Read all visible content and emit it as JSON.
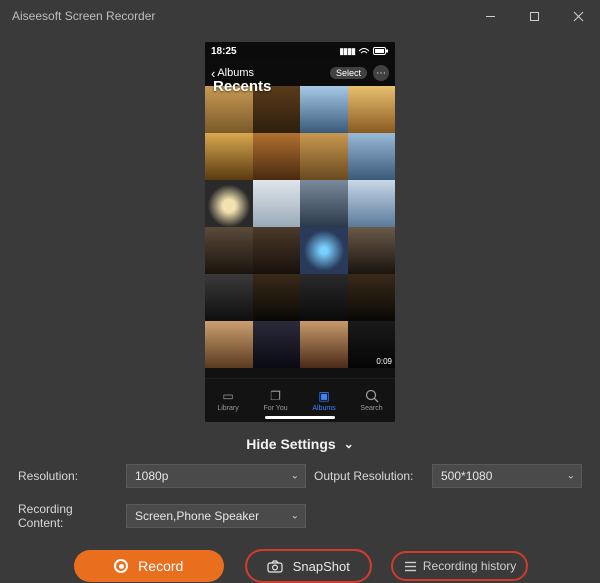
{
  "window": {
    "title": "Aiseesoft Screen Recorder"
  },
  "phone": {
    "status": {
      "time": "18:25"
    },
    "nav": {
      "back_label": "Albums",
      "select_label": "Select",
      "title": "Recents",
      "video_duration": "0:09"
    },
    "tabs": [
      {
        "label": "Library"
      },
      {
        "label": "For You"
      },
      {
        "label": "Albums"
      },
      {
        "label": "Search"
      }
    ]
  },
  "toggle": {
    "hide_settings_label": "Hide Settings"
  },
  "settings": {
    "resolution_label": "Resolution:",
    "resolution_value": "1080p",
    "output_resolution_label": "Output Resolution:",
    "output_resolution_value": "500*1080",
    "recording_content_label": "Recording Content:",
    "recording_content_value": "Screen,Phone Speaker"
  },
  "actions": {
    "record_label": "Record",
    "snapshot_label": "SnapShot",
    "history_label": "Recording history"
  }
}
